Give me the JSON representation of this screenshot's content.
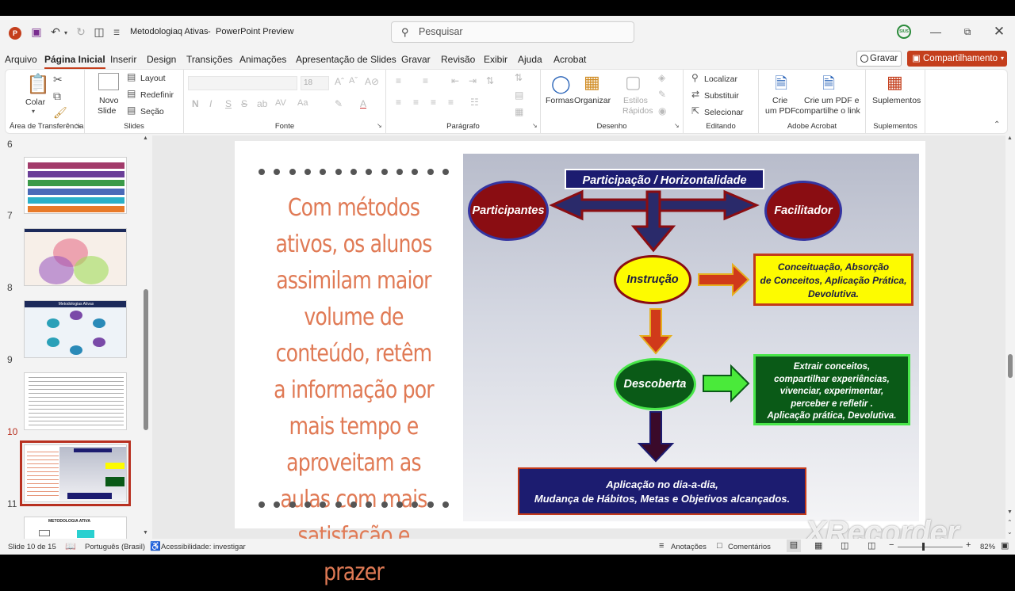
{
  "titlebar": {
    "doc_title": "Metodologiaq Ativas",
    "separator": "-",
    "app_name": "PowerPoint Preview",
    "search_placeholder": "Pesquisar",
    "avatar_initials": "SIUS"
  },
  "menu": {
    "tabs": [
      "Arquivo",
      "Página Inicial",
      "Inserir",
      "Design",
      "Transições",
      "Animações",
      "Apresentação de Slides",
      "Gravar",
      "Revisão",
      "Exibir",
      "Ajuda",
      "Acrobat"
    ],
    "record_label": "Gravar",
    "share_label": "Compartilhamento"
  },
  "ribbon": {
    "paste_label": "Colar",
    "clipboard_group": "Área de Transferência",
    "new_slide_label_1": "Novo",
    "new_slide_label_2": "Slide",
    "layout_label": "Layout",
    "reset_label": "Redefinir",
    "section_label": "Seção",
    "slides_group": "Slides",
    "font_size": "18",
    "bold": "N",
    "italic": "I",
    "underline": "S",
    "strike": "S",
    "font_group": "Fonte",
    "paragraph_group": "Parágrafo",
    "shapes_label": "Formas",
    "arrange_label": "Organizar",
    "quick_styles_1": "Estilos",
    "quick_styles_2": "Rápidos",
    "drawing_group": "Desenho",
    "find_label": "Localizar",
    "replace_label": "Substituir",
    "select_label": "Selecionar",
    "editing_group": "Editando",
    "create_pdf_1": "Crie",
    "create_pdf_2": "um PDF",
    "create_pdf_share_1": "Crie um PDF e",
    "create_pdf_share_2": "compartilhe o link",
    "acrobat_group": "Adobe Acrobat",
    "addins_label": "Suplementos",
    "addins_group": "Suplementos"
  },
  "thumbnails": {
    "numbers": [
      "6",
      "7",
      "8",
      "9",
      "10",
      "11"
    ],
    "selected": "10",
    "slide8_title": "Metodologias Ativas",
    "slide11_title": "METODOLOGIA ATIVA"
  },
  "slide": {
    "main_text": "Com métodos ativos, os alunos assimilam maior volume de conteúdo, retêm a informação por mais tempo e aproveitam as aulas com mais satisfação e prazer",
    "top_banner": "Participação  /  Horizontalidade",
    "participants": "Participantes",
    "facilitator": "Facilitador",
    "instruction": "Instrução",
    "discovery": "Descoberta",
    "yellow_lines": [
      "Conceituação, Absorção",
      "de Conceitos, Aplicação Prática,",
      "Devolutiva."
    ],
    "green_lines": [
      "Extrair conceitos,",
      "compartilhar experiências,",
      "vivenciar, experimentar,",
      "perceber e refletir .",
      "Aplicação prática, Devolutiva."
    ],
    "bottom_lines": [
      "Aplicação no dia-a-dia,",
      "Mudança de Hábitos, Metas e Objetivos alcançados."
    ],
    "colors": {
      "text_orange": "#e07a55",
      "navy": "#1c1c70",
      "maroon": "#8a0d12",
      "yellow": "#fdfb00",
      "green": "#0a5a17"
    }
  },
  "watermark": "XRecorder",
  "status": {
    "slide_pos": "Slide 10 de 15",
    "language": "Português (Brasil)",
    "accessibility": "Acessibilidade: investigar",
    "notes": "Anotações",
    "comments": "Comentários",
    "zoom": "82%"
  }
}
